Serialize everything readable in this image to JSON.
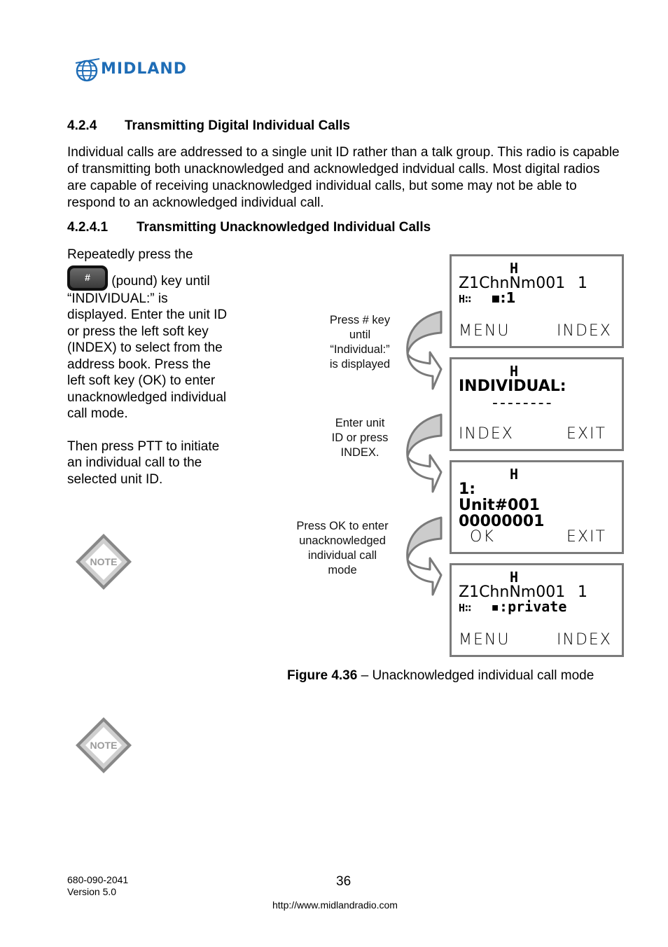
{
  "header": {
    "logo_text": "MIDLAND",
    "logo_color": "#1f6db6"
  },
  "section": {
    "number": "4.2.4",
    "title": "Transmitting Digital Individual Calls",
    "paragraph": "Individual calls are addressed to a single unit ID rather than a talk group. This radio is capable of transmitting both unacknowledged and acknowledged indvidual calls. Most digital radios are capable of receiving unacknowledged individual calls, but some may not be able to respond to an acknowledged individual call."
  },
  "subsection": {
    "number": "4.2.4.1",
    "title": "Transmitting Unacknowledged Individual Calls"
  },
  "instructions": {
    "line1": "Repeatedly press the",
    "key_label": "#",
    "after_key": " (pound) key until “INDIVIDUAL:” is displayed. Enter the unit ID or press the left soft key (INDEX) to select from the address book. Press the left soft key (OK) to enter unacknowledged individual call mode.",
    "paragraph2": "Then press PTT to initiate an individual call to the selected unit ID."
  },
  "notes": [
    {
      "label": "NOTE"
    },
    {
      "label": "NOTE"
    }
  ],
  "callouts": [
    {
      "lines": [
        "Press # key",
        "until",
        "“Individual:”",
        "is displayed"
      ]
    },
    {
      "lines": [
        "Enter unit",
        "ID or press",
        "INDEX."
      ]
    },
    {
      "lines": [
        "Press OK to enter",
        "unacknowledged",
        "individual call",
        "mode"
      ]
    }
  ],
  "screens": [
    {
      "indicator": "H",
      "line1": "Z1ChnNm001",
      "channel": "1",
      "line2": "▪:1",
      "left_soft": "MENU",
      "right_soft": "INDEX"
    },
    {
      "indicator": "H",
      "line1": "INDIVIDUAL:",
      "line2": "--------",
      "left_soft": "INDEX",
      "right_soft": "EXIT"
    },
    {
      "indicator": "H",
      "line1": "1:",
      "line2": "Unit#001",
      "line3": "00000001",
      "left_soft": "OK",
      "right_soft": "EXIT"
    },
    {
      "indicator": "H",
      "line1": "Z1ChnNm001",
      "channel": "1",
      "line2": "▪:private",
      "left_soft": "MENU",
      "right_soft": "INDEX"
    }
  ],
  "figure": {
    "label": "Figure 4.36",
    "caption": " – Unacknowledged individual call mode"
  },
  "footer": {
    "doc_number": "680-090-2041",
    "version": "Version 5.0",
    "page_number": "36",
    "url": "http://www.midlandradio.com"
  }
}
